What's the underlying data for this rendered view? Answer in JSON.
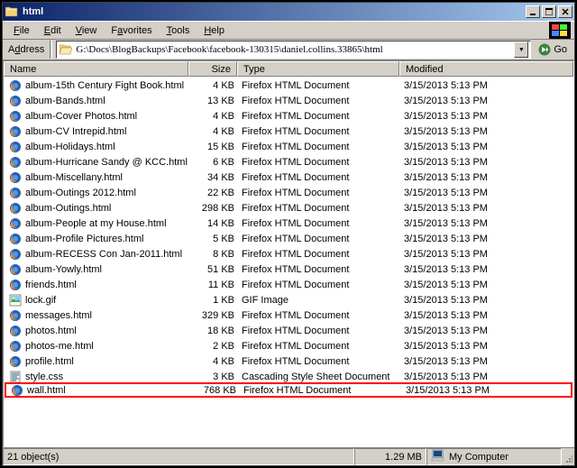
{
  "titlebar": {
    "title": "html"
  },
  "menu": {
    "file": "File",
    "edit": "Edit",
    "view": "View",
    "favorites": "Favorites",
    "tools": "Tools",
    "help": "Help"
  },
  "address": {
    "label": "Address",
    "path": "G:\\Docs\\BlogBackups\\Facebook\\facebook-130315\\daniel.collins.33865\\html",
    "go": "Go"
  },
  "columns": {
    "name": "Name",
    "size": "Size",
    "type": "Type",
    "modified": "Modified"
  },
  "status": {
    "objects": "21 object(s)",
    "size": "1.29 MB",
    "location": "My Computer"
  },
  "files": [
    {
      "name": "album-15th Century Fight Book.html",
      "size": "4 KB",
      "type": "Firefox HTML Document",
      "modified": "3/15/2013 5:13 PM",
      "icon": "ff"
    },
    {
      "name": "album-Bands.html",
      "size": "13 KB",
      "type": "Firefox HTML Document",
      "modified": "3/15/2013 5:13 PM",
      "icon": "ff"
    },
    {
      "name": "album-Cover Photos.html",
      "size": "4 KB",
      "type": "Firefox HTML Document",
      "modified": "3/15/2013 5:13 PM",
      "icon": "ff"
    },
    {
      "name": "album-CV Intrepid.html",
      "size": "4 KB",
      "type": "Firefox HTML Document",
      "modified": "3/15/2013 5:13 PM",
      "icon": "ff"
    },
    {
      "name": "album-Holidays.html",
      "size": "15 KB",
      "type": "Firefox HTML Document",
      "modified": "3/15/2013 5:13 PM",
      "icon": "ff"
    },
    {
      "name": "album-Hurricane Sandy @ KCC.html",
      "size": "6 KB",
      "type": "Firefox HTML Document",
      "modified": "3/15/2013 5:13 PM",
      "icon": "ff"
    },
    {
      "name": "album-Miscellany.html",
      "size": "34 KB",
      "type": "Firefox HTML Document",
      "modified": "3/15/2013 5:13 PM",
      "icon": "ff"
    },
    {
      "name": "album-Outings 2012.html",
      "size": "22 KB",
      "type": "Firefox HTML Document",
      "modified": "3/15/2013 5:13 PM",
      "icon": "ff"
    },
    {
      "name": "album-Outings.html",
      "size": "298 KB",
      "type": "Firefox HTML Document",
      "modified": "3/15/2013 5:13 PM",
      "icon": "ff"
    },
    {
      "name": "album-People at my House.html",
      "size": "14 KB",
      "type": "Firefox HTML Document",
      "modified": "3/15/2013 5:13 PM",
      "icon": "ff"
    },
    {
      "name": "album-Profile Pictures.html",
      "size": "5 KB",
      "type": "Firefox HTML Document",
      "modified": "3/15/2013 5:13 PM",
      "icon": "ff"
    },
    {
      "name": "album-RECESS Con Jan-2011.html",
      "size": "8 KB",
      "type": "Firefox HTML Document",
      "modified": "3/15/2013 5:13 PM",
      "icon": "ff"
    },
    {
      "name": "album-Yowly.html",
      "size": "51 KB",
      "type": "Firefox HTML Document",
      "modified": "3/15/2013 5:13 PM",
      "icon": "ff"
    },
    {
      "name": "friends.html",
      "size": "11 KB",
      "type": "Firefox HTML Document",
      "modified": "3/15/2013 5:13 PM",
      "icon": "ff"
    },
    {
      "name": "lock.gif",
      "size": "1 KB",
      "type": "GIF Image",
      "modified": "3/15/2013 5:13 PM",
      "icon": "gif"
    },
    {
      "name": "messages.html",
      "size": "329 KB",
      "type": "Firefox HTML Document",
      "modified": "3/15/2013 5:13 PM",
      "icon": "ff"
    },
    {
      "name": "photos.html",
      "size": "18 KB",
      "type": "Firefox HTML Document",
      "modified": "3/15/2013 5:13 PM",
      "icon": "ff"
    },
    {
      "name": "photos-me.html",
      "size": "2 KB",
      "type": "Firefox HTML Document",
      "modified": "3/15/2013 5:13 PM",
      "icon": "ff"
    },
    {
      "name": "profile.html",
      "size": "4 KB",
      "type": "Firefox HTML Document",
      "modified": "3/15/2013 5:13 PM",
      "icon": "ff"
    },
    {
      "name": "style.css",
      "size": "3 KB",
      "type": "Cascading Style Sheet Document",
      "modified": "3/15/2013 5:13 PM",
      "icon": "css"
    },
    {
      "name": "wall.html",
      "size": "768 KB",
      "type": "Firefox HTML Document",
      "modified": "3/15/2013 5:13 PM",
      "icon": "ff",
      "highlighted": true
    }
  ]
}
